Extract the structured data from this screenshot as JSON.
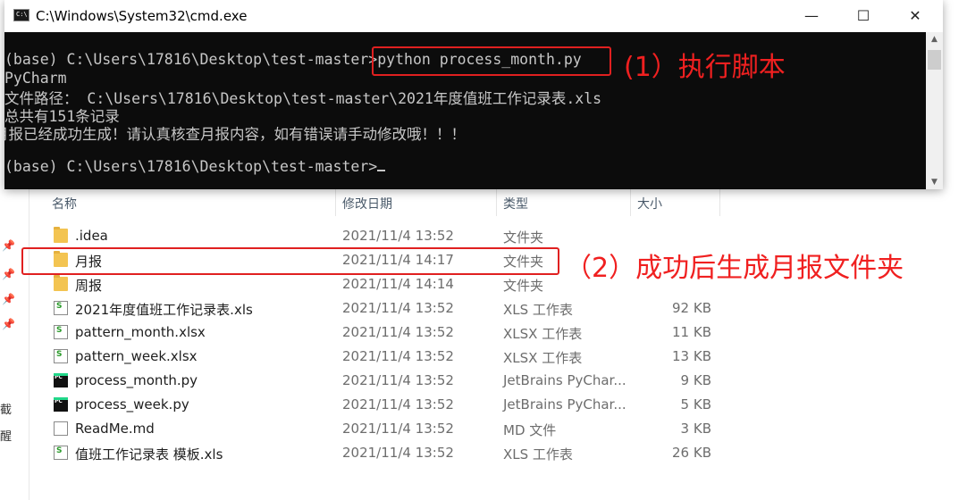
{
  "cmd": {
    "title": "C:\\Windows\\System32\\cmd.exe",
    "controls": {
      "minimize": "—",
      "maximize": "☐",
      "close": "✕"
    },
    "lines": [
      "(base) C:\\Users\\17816\\Desktop\\test-master>python process_month.py",
      "PyCharm",
      "文件路径： C:\\Users\\17816\\Desktop\\test-master\\2021年度值班工作记录表.xls",
      "总共有151条记录",
      "月报已经成功生成！请认真核查月报内容，如有错误请手动修改哦！！！",
      "(base) C:\\Users\\17816\\Desktop\\test-master>"
    ]
  },
  "explorer": {
    "columns": {
      "name": "名称",
      "date": "修改日期",
      "type": "类型",
      "size": "大小"
    },
    "files": [
      {
        "name": ".idea",
        "date": "2021/11/4 13:52",
        "type": "文件夹",
        "size": "",
        "icon": "folder"
      },
      {
        "name": "月报",
        "date": "2021/11/4 14:17",
        "type": "文件夹",
        "size": "",
        "icon": "folder"
      },
      {
        "name": "周报",
        "date": "2021/11/4 14:14",
        "type": "文件夹",
        "size": "",
        "icon": "folder"
      },
      {
        "name": "2021年度值班工作记录表.xls",
        "date": "2021/11/4 13:52",
        "type": "XLS 工作表",
        "size": "92 KB",
        "icon": "xls"
      },
      {
        "name": "pattern_month.xlsx",
        "date": "2021/11/4 13:52",
        "type": "XLSX 工作表",
        "size": "11 KB",
        "icon": "xls"
      },
      {
        "name": "pattern_week.xlsx",
        "date": "2021/11/4 13:52",
        "type": "XLSX 工作表",
        "size": "13 KB",
        "icon": "xls"
      },
      {
        "name": "process_month.py",
        "date": "2021/11/4 13:52",
        "type": "JetBrains PyChar...",
        "size": "9 KB",
        "icon": "py"
      },
      {
        "name": "process_week.py",
        "date": "2021/11/4 13:52",
        "type": "JetBrains PyChar...",
        "size": "5 KB",
        "icon": "py"
      },
      {
        "name": "ReadMe.md",
        "date": "2021/11/4 13:52",
        "type": "MD 文件",
        "size": "3 KB",
        "icon": "md"
      },
      {
        "name": "值班工作记录表 模板.xls",
        "date": "2021/11/4 13:52",
        "type": "XLS 工作表",
        "size": "26 KB",
        "icon": "xls"
      }
    ],
    "left_glyphs": [
      "截",
      "醒"
    ]
  },
  "annotations": {
    "step1": "(1）执行脚本",
    "step2": "（2）成功后生成月报文件夹",
    "color": "#e02020"
  }
}
